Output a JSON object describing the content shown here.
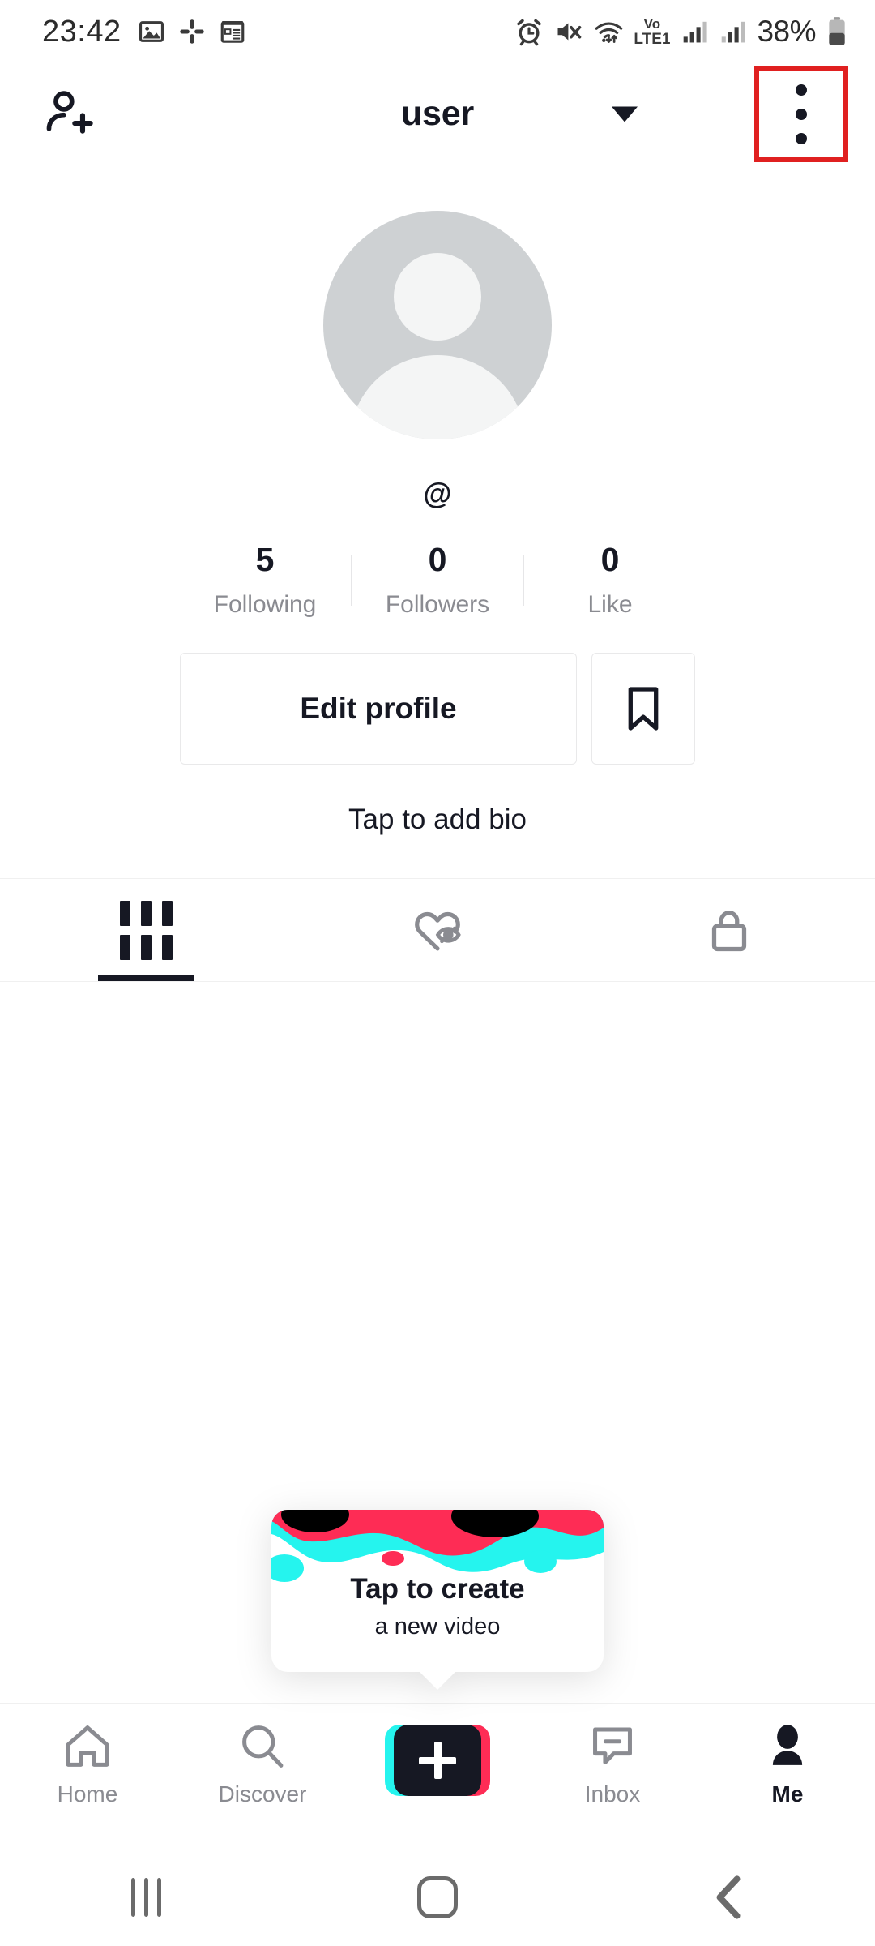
{
  "status_bar": {
    "time": "23:42",
    "left_icons": [
      "image-icon",
      "slack-icon",
      "calendar-icon"
    ],
    "right_icons": [
      "alarm-icon",
      "volume-muted-icon",
      "wifi-icon",
      "signal-icon-1",
      "signal-icon-2",
      "battery-icon"
    ],
    "network_label_top": "Vo",
    "network_label_bottom": "LTE1",
    "battery_percent": "38%"
  },
  "header": {
    "add_friend_icon": "person-add-icon",
    "title": "user",
    "caret_icon": "chevron-down-icon",
    "menu_icon": "kebab-menu-icon",
    "highlight_color": "#e02020"
  },
  "profile": {
    "avatar_icon": "default-avatar-icon",
    "handle": "@",
    "stats": [
      {
        "value": "5",
        "label": "Following"
      },
      {
        "value": "0",
        "label": "Followers"
      },
      {
        "value": "0",
        "label": "Like"
      }
    ],
    "edit_button": "Edit profile",
    "bookmark_icon": "bookmark-icon",
    "bio": "Tap to add bio"
  },
  "tabs": [
    {
      "name": "videos-grid-tab",
      "icon": "grid-icon",
      "active": true
    },
    {
      "name": "liked-tab",
      "icon": "heart-hidden-icon",
      "active": false
    },
    {
      "name": "private-tab",
      "icon": "lock-icon",
      "active": false
    }
  ],
  "create_card": {
    "title": "Tap to create",
    "subtitle": "a new video",
    "colors": {
      "cyan": "#25f4ee",
      "red": "#fe2c55",
      "black": "#000000"
    }
  },
  "bottom_nav": [
    {
      "label": "Home",
      "icon": "home-icon",
      "active": false
    },
    {
      "label": "Discover",
      "icon": "search-icon",
      "active": false
    },
    {
      "label": "",
      "icon": "create-plus-icon",
      "active": false
    },
    {
      "label": "Inbox",
      "icon": "inbox-icon",
      "active": false
    },
    {
      "label": "Me",
      "icon": "person-icon",
      "active": true
    }
  ],
  "system_nav": {
    "recents_icon": "recents-icon",
    "home_icon": "home-square-icon",
    "back_icon": "back-chevron-icon"
  }
}
